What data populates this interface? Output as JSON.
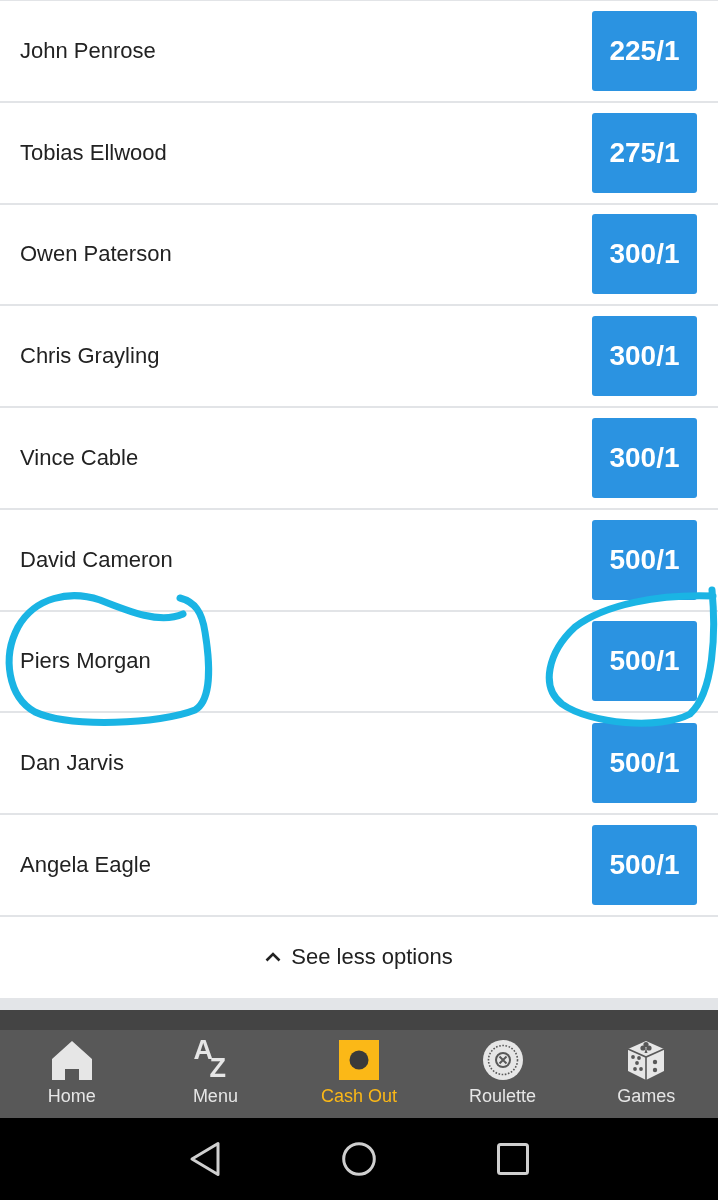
{
  "selections": [
    {
      "name": "John Penrose",
      "odds": "225/1",
      "circled": false
    },
    {
      "name": "Tobias Ellwood",
      "odds": "275/1",
      "circled": false
    },
    {
      "name": "Owen Paterson",
      "odds": "300/1",
      "circled": false
    },
    {
      "name": "Chris Grayling",
      "odds": "300/1",
      "circled": false
    },
    {
      "name": "Vince Cable",
      "odds": "300/1",
      "circled": false
    },
    {
      "name": "David Cameron",
      "odds": "500/1",
      "circled": false
    },
    {
      "name": "Piers Morgan",
      "odds": "500/1",
      "circled": true
    },
    {
      "name": "Dan Jarvis",
      "odds": "500/1",
      "circled": false
    },
    {
      "name": "Angela Eagle",
      "odds": "500/1",
      "circled": false
    }
  ],
  "toggle": {
    "label": "See less options",
    "expanded": true
  },
  "bottom_nav": [
    {
      "label": "Home",
      "kind": "home",
      "selected": false
    },
    {
      "label": "Menu",
      "kind": "letters",
      "icon_text": [
        "A",
        "Z"
      ],
      "selected": false
    },
    {
      "label": "Cash Out",
      "kind": "cashout",
      "selected": true
    },
    {
      "label": "Roulette",
      "kind": "roulette",
      "selected": false
    },
    {
      "label": "Games",
      "kind": "dice",
      "selected": false
    }
  ]
}
